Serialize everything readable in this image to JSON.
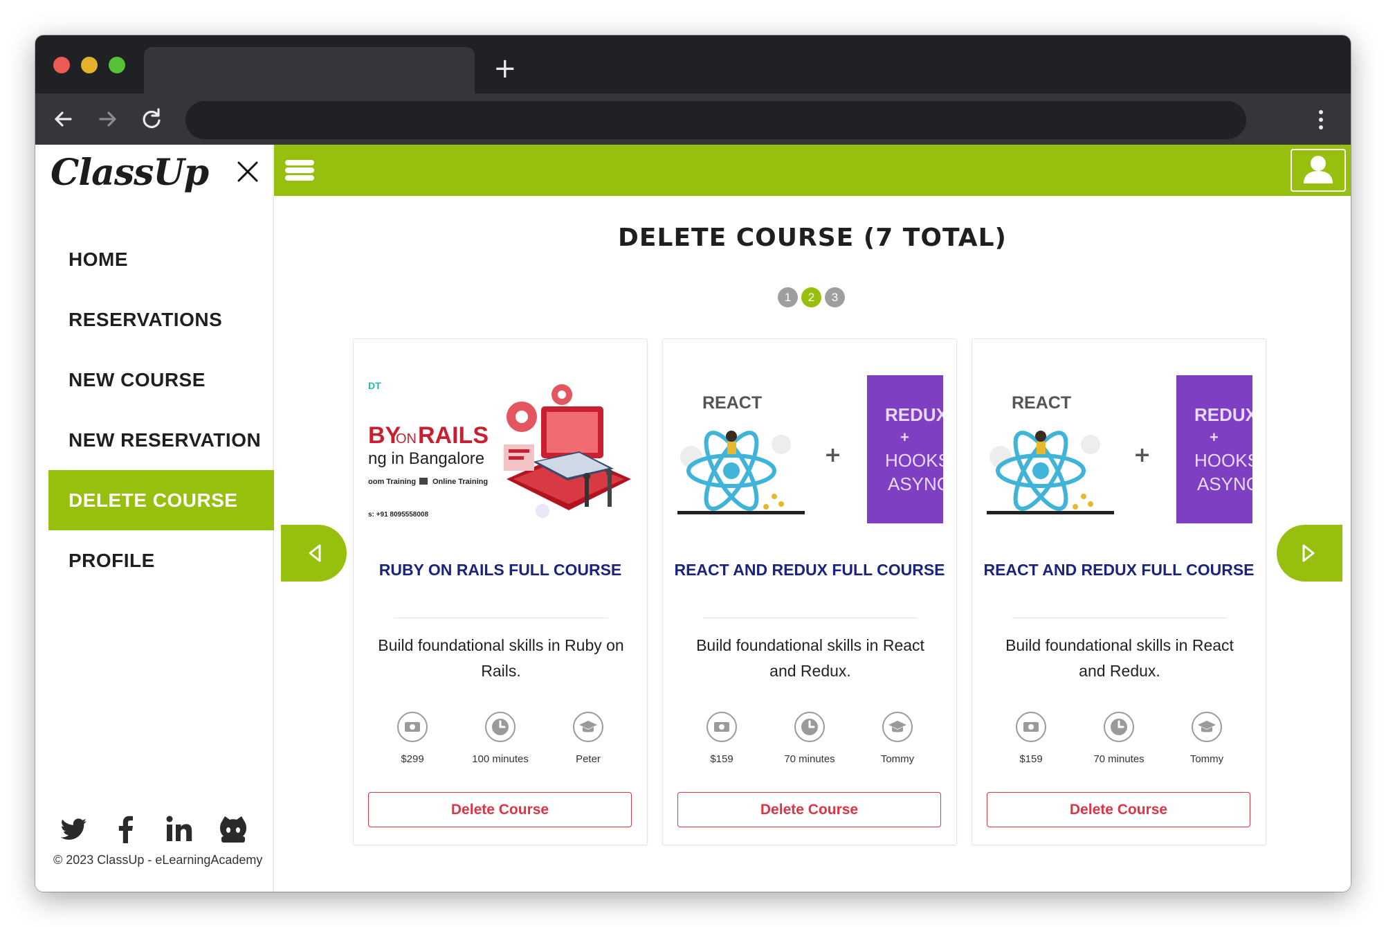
{
  "app": {
    "logo": "ClassUp"
  },
  "sidebar": {
    "items": [
      {
        "label": "HOME"
      },
      {
        "label": "RESERVATIONS"
      },
      {
        "label": "NEW COURSE"
      },
      {
        "label": "NEW RESERVATION"
      },
      {
        "label": "DELETE COURSE",
        "active": true
      },
      {
        "label": "PROFILE"
      }
    ],
    "social_icons": [
      "twitter-icon",
      "facebook-icon",
      "linkedin-icon",
      "github-icon"
    ],
    "copyright": "© 2023 ClassUp - eLearningAcademy"
  },
  "main": {
    "title": "DELETE COURSE (7 TOTAL)",
    "pagination": {
      "pages": [
        "1",
        "2",
        "3"
      ],
      "current": "2"
    }
  },
  "cards": [
    {
      "title": "RUBY ON RAILS FULL COURSE",
      "description": "Build foundational skills in Ruby on Rails.",
      "price": "$299",
      "duration": "100 minutes",
      "instructor": "Peter",
      "button": "Delete Course",
      "image": {
        "corner": "DT",
        "heading_a": "BY",
        "heading_on": "ON",
        "heading_b": "RAILS",
        "sub": "ng  in Bangalore",
        "tag1": "oom Training",
        "tag2": "Online Training",
        "phone": "s: +91 8095558008"
      }
    },
    {
      "title": "REACT AND REDUX FULL COURSE",
      "description": "Build foundational skills in React and Redux.",
      "price": "$159",
      "duration": "70 minutes",
      "instructor": "Tommy",
      "button": "Delete Course",
      "image": {
        "left": "REACT",
        "plus": "+",
        "r1": "REDUX",
        "r2": "+",
        "r3": "HOOKS",
        "r4": "ASYNC"
      }
    },
    {
      "title": "REACT AND REDUX FULL COURSE",
      "description": "Build foundational skills in React and Redux.",
      "price": "$159",
      "duration": "70 minutes",
      "instructor": "Tommy",
      "button": "Delete Course",
      "image": {
        "left": "REACT",
        "plus": "+",
        "r1": "REDUX",
        "r2": "+",
        "r3": "HOOKS",
        "r4": "ASYNC"
      }
    }
  ],
  "colors": {
    "accent": "#97bf0d",
    "danger": "#dc3545",
    "title_navy": "#1a237e",
    "browser_dark": "#202124"
  }
}
